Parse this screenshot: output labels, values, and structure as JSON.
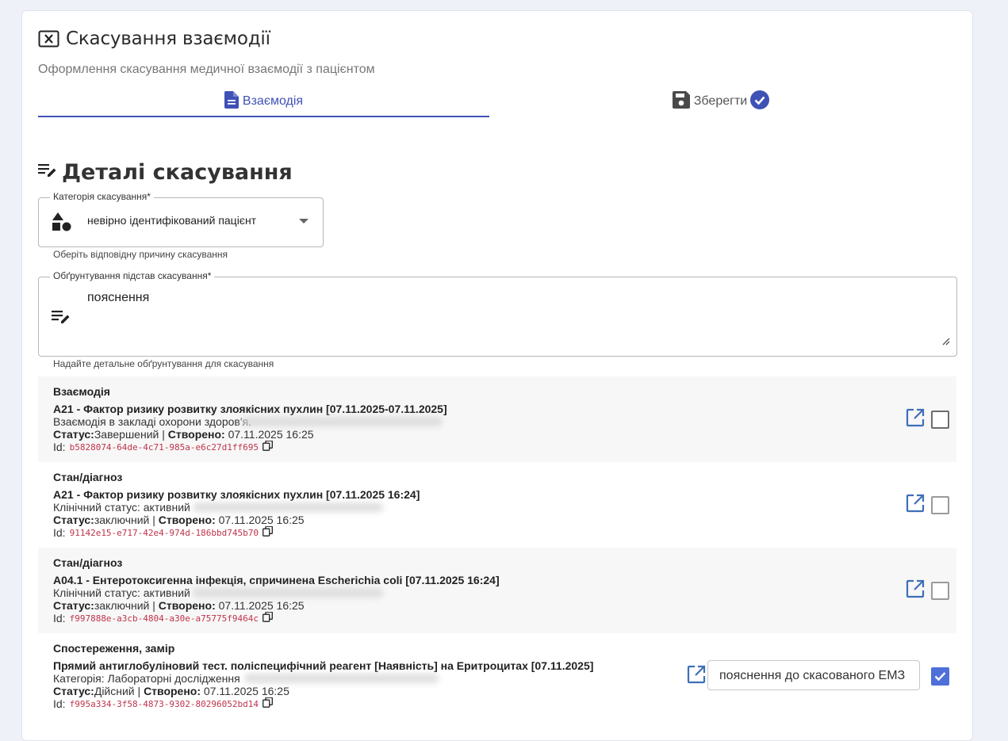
{
  "header": {
    "title": "Скасування взаємодії",
    "subtitle": "Оформлення скасування медичної взаємодії з пацієнтом"
  },
  "tabs": [
    {
      "label": "Взаємодія",
      "active": true
    },
    {
      "label": "Зберегти",
      "active": false
    }
  ],
  "section": {
    "title": "Деталі скасування"
  },
  "category": {
    "legend": "Категорія скасування*",
    "value": "невірно ідентифікований пацієнт",
    "helper": "Оберіть відповідну причину скасування"
  },
  "justification": {
    "legend": "Обґрунтування підстав скасування*",
    "value": "пояснення",
    "helper": "Надайте детальне обґрунтування для скасування"
  },
  "items": [
    {
      "type": "Взаємодія",
      "name": "A21 - Фактор ризику розвитку злоякісних пухлин [07.11.2025-07.11.2025]",
      "line3": "Взаємодія в закладі охорони здоров'я.",
      "status_label": "Статус:",
      "status": "Завершений",
      "sep": " | ",
      "created_label": "Створено:",
      "created": "07.11.2025 16:25",
      "id_label": "Id:",
      "id": "b5828074-64de-4c71-985a-e6c27d1ff695",
      "checked": false
    },
    {
      "type": "Стан/діагноз",
      "name": "A21 - Фактор ризику розвитку злоякісних пухлин [07.11.2025 16:24]",
      "line3": "Клінічний статус: активний",
      "status_label": "Статус:",
      "status": "заключний",
      "sep": " | ",
      "created_label": "Створено:",
      "created": "07.11.2025 16:25",
      "id_label": "Id:",
      "id": "91142e15-e717-42e4-974d-186bbd745b70",
      "checked": false
    },
    {
      "type": "Стан/діагноз",
      "name": "A04.1 - Ентеротоксигенна інфекція, спричинена Escherichia coli [07.11.2025 16:24]",
      "line3": "Клінічний статус: активний",
      "status_label": "Статус:",
      "status": "заключний",
      "sep": " | ",
      "created_label": "Створено:",
      "created": "07.11.2025 16:25",
      "id_label": "Id:",
      "id": "f997888e-a3cb-4804-a30e-a75775f9464c",
      "checked": false
    },
    {
      "type": "Спостереження, замір",
      "name": "Прямий антиглобуліновий тест. поліспецифічний реагент [Наявність] на Еритроцитах [07.11.2025]",
      "line3": "Категорія: Лабораторні дослідження",
      "status_label": "Статус:",
      "status": "Дійсний",
      "sep": " | ",
      "created_label": "Створено:",
      "created": "07.11.2025 16:25",
      "id_label": "Id:",
      "id": "f995a334-3f58-4873-9302-80296052bd14",
      "checked": true,
      "reason_value": "пояснення до скасованого ЕМЗ"
    }
  ],
  "colors": {
    "accent": "#3f51b5",
    "checkbox": "#4f6fd9",
    "uuid": "#c0334a",
    "icon_blue": "#3d6fb8"
  }
}
